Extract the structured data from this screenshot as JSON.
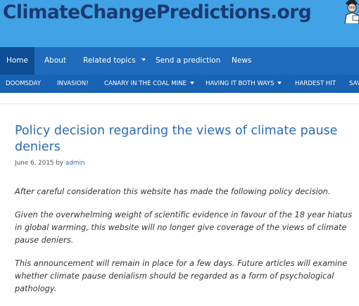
{
  "site": {
    "title": "ClimateChangePredictions.org"
  },
  "nav_main": {
    "items": [
      {
        "label": "Home",
        "active": true,
        "dropdown": false
      },
      {
        "label": "About",
        "dropdown": false
      },
      {
        "label": "Related topics",
        "dropdown": true
      },
      {
        "label": "Send a prediction",
        "dropdown": false
      },
      {
        "label": "News",
        "dropdown": false
      }
    ]
  },
  "nav_sub": {
    "items": [
      {
        "label": "DOOMSDAY",
        "dropdown": false
      },
      {
        "label": "INVASION!",
        "dropdown": false
      },
      {
        "label": "CANARY IN THE COAL MINE",
        "dropdown": true
      },
      {
        "label": "HAVING IT BOTH WAYS",
        "dropdown": true
      },
      {
        "label": "HARDEST HIT",
        "dropdown": false
      },
      {
        "label": "SAV",
        "dropdown": false
      }
    ]
  },
  "post": {
    "title": "Policy decision regarding the views of climate pause deniers",
    "date": "June 6, 2015",
    "by": "by",
    "author": "admin",
    "paragraphs": [
      "After careful consideration this website has made the following policy decision.",
      "Given the overwhelming weight of scientific evidence in favour of the 18 year hiatus in global warming, this website will no longer give coverage of the views of climate pause deniers.",
      "This announcement will remain in place for a few days. Future articles will examine whether climate pause denialism should be regarded as a form of psychological pathology."
    ]
  },
  "colors": {
    "header_bg": "#41a3e5",
    "title_text": "#1b3a73",
    "nav_main_bg": "#1e6bbb",
    "nav_active_bg": "#0c4d93",
    "nav_sub_bg": "#1762b3",
    "link": "#2b6cb3"
  },
  "icons": {
    "mascot": "cartoon-figure-icon",
    "dropdown": "caret-down-icon"
  }
}
